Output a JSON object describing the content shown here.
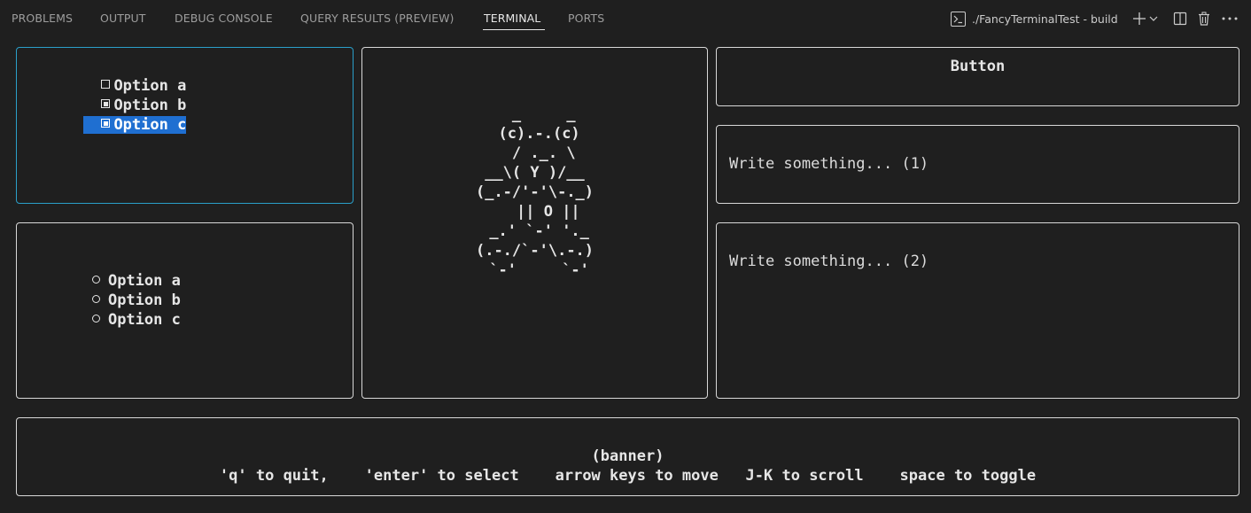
{
  "panel": {
    "tabs": [
      {
        "label": "PROBLEMS"
      },
      {
        "label": "OUTPUT"
      },
      {
        "label": "DEBUG CONSOLE"
      },
      {
        "label": "QUERY RESULTS (PREVIEW)"
      },
      {
        "label": "TERMINAL",
        "active": true
      },
      {
        "label": "PORTS"
      }
    ],
    "terminal_title": "./FancyTerminalTest - build",
    "actions": [
      "new-terminal-icon",
      "dropdown-icon",
      "split-terminal-icon",
      "trash-icon",
      "more-actions-icon"
    ]
  },
  "checkboxes": {
    "items": [
      {
        "label": "Option a",
        "checked": false
      },
      {
        "label": "Option b",
        "checked": true
      },
      {
        "label": "Option c",
        "checked": true,
        "selected": true
      }
    ]
  },
  "radios": {
    "items": [
      {
        "label": "Option a"
      },
      {
        "label": "Option b"
      },
      {
        "label": "Option c"
      }
    ]
  },
  "art": {
    "text": "  _     _\n (c).-.(c)\n  / ._. \\\n__\\( Y )/__\n(_.-/'-'\\-._)\n   || O ||\n _.' `-' '._\n(.-./`-'\\.-.)\n `-'     `-'"
  },
  "button": {
    "label": "Button"
  },
  "inputs": {
    "first_placeholder": "Write something... (1)",
    "second_placeholder": "Write something... (2)"
  },
  "banner": {
    "title": "(banner)",
    "help": "'q' to quit,    'enter' to select    arrow keys to move   J-K to scroll    space to toggle"
  },
  "colors": {
    "background": "#1f1f1f",
    "border": "#d8d8d8",
    "focus_border": "#2a9fc9",
    "selection": "#1f6fd1"
  }
}
